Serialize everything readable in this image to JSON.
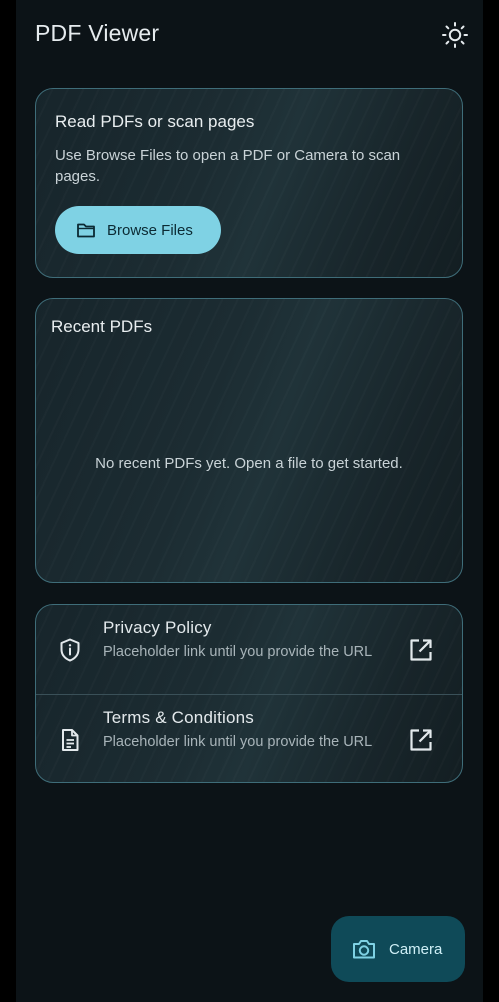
{
  "header": {
    "title": "PDF Viewer",
    "theme_icon": "sun-icon"
  },
  "intro_card": {
    "title": "Read PDFs or scan pages",
    "description": "Use Browse Files to open a PDF or Camera to scan pages.",
    "browse_button": {
      "label": "Browse Files",
      "icon": "folder-icon"
    }
  },
  "recent_card": {
    "title": "Recent PDFs",
    "empty_message": "No recent PDFs yet. Open a file to get started."
  },
  "links": [
    {
      "title": "Privacy Policy",
      "subtitle": "Placeholder link until you provide the URL",
      "icon": "shield-info-icon",
      "action_icon": "open-in-new-icon"
    },
    {
      "title": "Terms & Conditions",
      "subtitle": "Placeholder link until you provide the URL",
      "icon": "document-icon",
      "action_icon": "open-in-new-icon"
    }
  ],
  "fab": {
    "label": "Camera",
    "icon": "camera-icon"
  },
  "colors": {
    "background": "#0c1317",
    "card_border": "#3f6d79",
    "primary_button": "#7fd2e4",
    "fab_background": "#0f4a58",
    "fab_accent": "#7fd2e4"
  }
}
